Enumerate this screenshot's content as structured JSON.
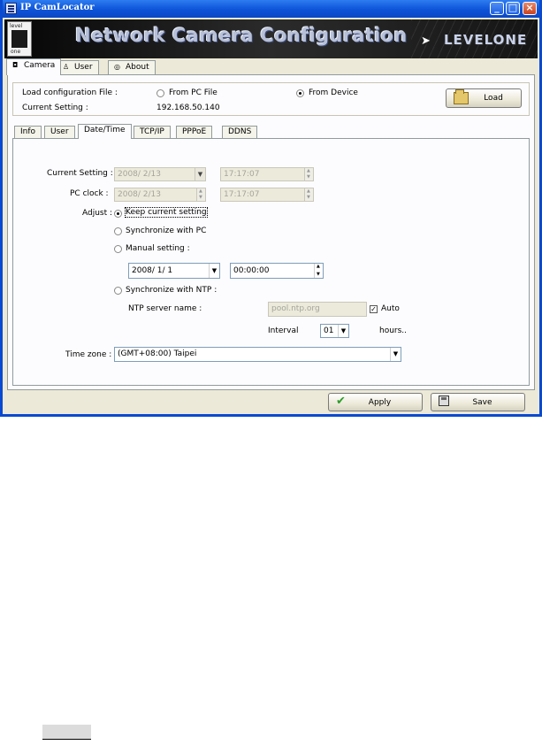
{
  "window": {
    "title": "IP CamLocator"
  },
  "banner": {
    "logo_top": "level",
    "logo_bottom": "one",
    "heading": "Network Camera Configuration",
    "brand": "LEVELONE"
  },
  "main_tabs": [
    {
      "label": "Camera",
      "icon": "camera-icon"
    },
    {
      "label": "User",
      "icon": "user-icon"
    },
    {
      "label": "About",
      "icon": "info-icon"
    }
  ],
  "load": {
    "label": "Load configuration File :",
    "option_pc": "From PC File",
    "option_device": "From Device",
    "selected": "From Device",
    "current_label": "Current Setting :",
    "current_value": "192.168.50.140",
    "button": "Load"
  },
  "sub_tabs": [
    {
      "label": "Info"
    },
    {
      "label": "User"
    },
    {
      "label": "Date/Time",
      "active": true
    },
    {
      "label": "TCP/IP"
    },
    {
      "label": "PPPoE"
    },
    {
      "label": "DDNS"
    }
  ],
  "datetime": {
    "current_label": "Current Setting :",
    "current_date": "2008/ 2/13",
    "current_time": "17:17:07",
    "pc_label": "PC clock :",
    "pc_date": "2008/ 2/13",
    "pc_time": "17:17:07",
    "adjust_label": "Adjust :",
    "options": {
      "keep": "Keep current setting",
      "sync_pc": "Synchronize with PC",
      "manual": "Manual setting :",
      "sync_ntp": "Synchronize with NTP :"
    },
    "selected_option": "Keep current setting",
    "manual_date": "2008/  1/  1",
    "manual_time": "00:00:00",
    "ntp_label": "NTP server name :",
    "ntp_value": "pool.ntp.org",
    "auto_label": "Auto",
    "auto_checked": true,
    "interval_label": "Interval",
    "interval_value": "01",
    "interval_unit": "hours..",
    "timezone_label": "Time zone :",
    "timezone_value": "(GMT+08:00) Taipei"
  },
  "actions": {
    "apply": "Apply",
    "save": "Save"
  }
}
